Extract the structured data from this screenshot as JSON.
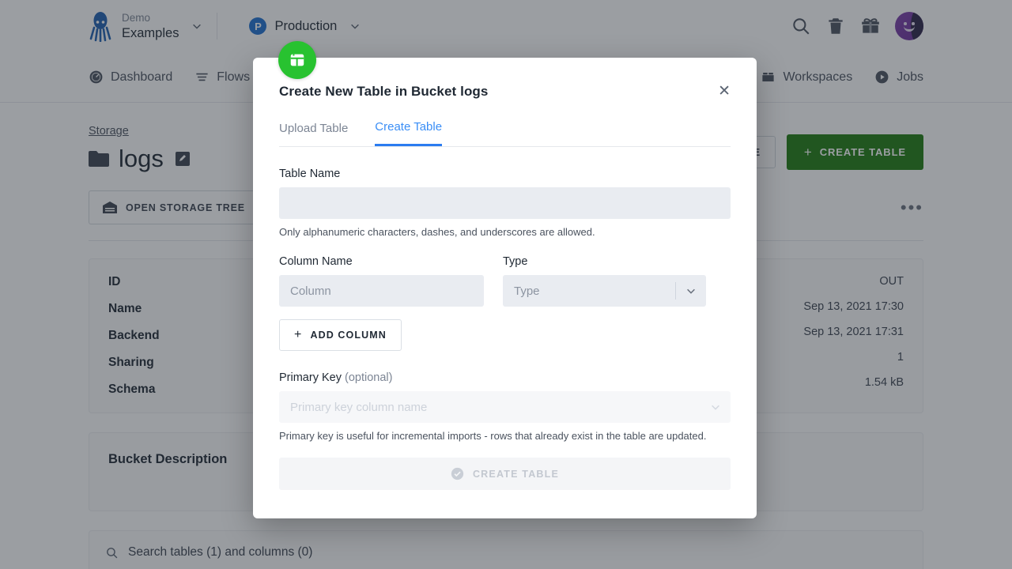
{
  "topbar": {
    "project_label": "Demo",
    "project_name": "Examples",
    "env_badge": "P",
    "env_name": "Production",
    "icons": {
      "search": "search-icon",
      "trash": "trash-icon",
      "gift": "gift-icon",
      "avatar": "user-avatar"
    }
  },
  "nav": {
    "items": [
      {
        "label": "Dashboard",
        "icon": "dashboard-icon"
      },
      {
        "label": "Flows",
        "icon": "flows-icon"
      },
      {
        "label": "Workspaces",
        "icon": "workspaces-icon"
      },
      {
        "label": "Jobs",
        "icon": "jobs-icon"
      }
    ]
  },
  "page": {
    "breadcrumb": "Storage",
    "title": "logs",
    "edit_icon": "pencil-icon",
    "folder_icon": "folder-icon",
    "upload_table_button": "UPLOAD TABLE",
    "create_table_button": "CREATE TABLE",
    "open_storage_tree_button": "OPEN STORAGE TREE",
    "more_actions": "•••",
    "info": {
      "keys": [
        "ID",
        "Name",
        "Backend",
        "Sharing",
        "Schema"
      ],
      "values": [
        "OUT",
        "Sep 13, 2021 17:30",
        "Sep 13, 2021 17:31",
        "1",
        "1.54 kB"
      ]
    },
    "bucket_description_title": "Bucket Description",
    "search_placeholder": "Search tables (1) and columns (0)"
  },
  "modal": {
    "badge_icon": "table-icon",
    "title": "Create New Table in Bucket logs",
    "close_label": "✕",
    "tabs": [
      {
        "label": "Upload Table",
        "active": false
      },
      {
        "label": "Create Table",
        "active": true
      }
    ],
    "table_name_label": "Table Name",
    "table_name_value": "",
    "table_name_placeholder": "",
    "table_name_help": "Only alphanumeric characters, dashes, and underscores are allowed.",
    "column_name_label": "Column Name",
    "column_name_placeholder": "Column",
    "column_name_value": "",
    "type_label": "Type",
    "type_placeholder": "Type",
    "add_column_button": "ADD COLUMN",
    "primary_key_label": "Primary Key",
    "primary_key_optional": "(optional)",
    "primary_key_placeholder": "Primary key column name",
    "primary_key_help": "Primary key is useful for incremental imports - rows that already exist in the table are updated.",
    "submit_button": "CREATE TABLE"
  },
  "colors": {
    "accent_green": "#1e7b10",
    "badge_green": "#28c230",
    "tab_active_blue": "#2b7cf0",
    "env_blue": "#1f6fd0",
    "avatar_purple": "#6b2f9c"
  }
}
